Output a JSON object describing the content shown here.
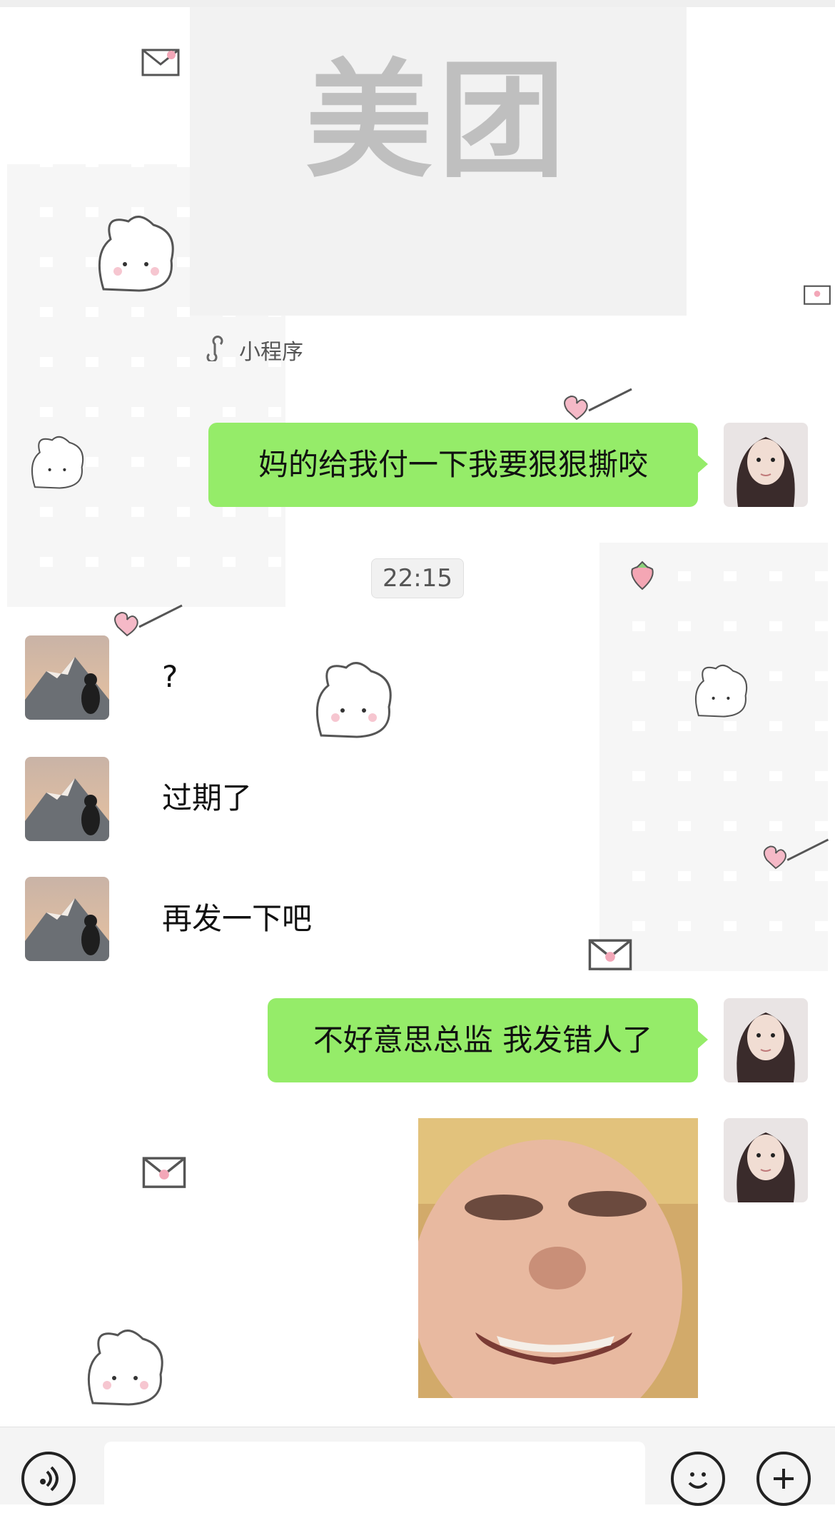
{
  "mini_program": {
    "logo_text": "美团",
    "footer_label": "小程序",
    "footer_icon": "mini-program-link-icon"
  },
  "messages": [
    {
      "side": "right",
      "text": "妈的给我付一下我要狠狠撕咬"
    },
    {
      "side": "left",
      "text": "?"
    },
    {
      "side": "left",
      "text": "过期了"
    },
    {
      "side": "left",
      "text": "再发一下吧"
    },
    {
      "side": "right",
      "text": "不好意思总监 我发错人了"
    }
  ],
  "timestamp": "22:15",
  "input_bar": {
    "placeholder": "",
    "voice_icon": "voice-icon",
    "emoji_icon": "emoji-icon",
    "plus_icon": "plus-icon"
  },
  "colors": {
    "bubble_green": "#95ec69",
    "background": "#ffffff",
    "bar": "#f4f4f4"
  }
}
